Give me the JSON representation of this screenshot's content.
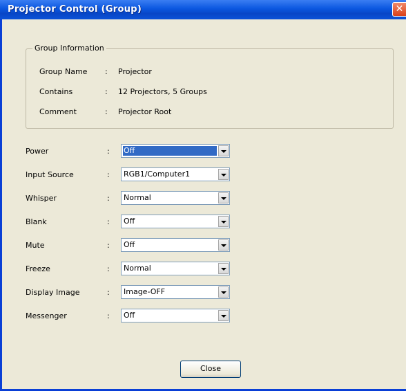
{
  "window": {
    "title": "Projector Control (Group)",
    "close_glyph": "✕"
  },
  "group_info": {
    "legend": "Group Information",
    "rows": [
      {
        "label": "Group Name",
        "colon": ":",
        "value": "Projector"
      },
      {
        "label": "Contains",
        "colon": ":",
        "value": "12 Projectors, 5 Groups"
      },
      {
        "label": "Comment",
        "colon": ":",
        "value": "Projector Root"
      }
    ]
  },
  "fields": [
    {
      "label": "Power",
      "colon": ":",
      "value": "Off",
      "selected": true
    },
    {
      "label": "Input Source",
      "colon": ":",
      "value": "RGB1/Computer1"
    },
    {
      "label": "Whisper",
      "colon": ":",
      "value": "Normal"
    },
    {
      "label": "Blank",
      "colon": ":",
      "value": "Off"
    },
    {
      "label": "Mute",
      "colon": ":",
      "value": "Off"
    },
    {
      "label": "Freeze",
      "colon": ":",
      "value": "Normal"
    },
    {
      "label": "Display Image",
      "colon": ":",
      "value": "Image-OFF"
    },
    {
      "label": "Messenger",
      "colon": ":",
      "value": "Off"
    }
  ],
  "buttons": {
    "close_label": "Close"
  },
  "colors": {
    "title_bar": "#0a57e0",
    "dialog_bg": "#ece9d8",
    "selection": "#316ac5"
  }
}
